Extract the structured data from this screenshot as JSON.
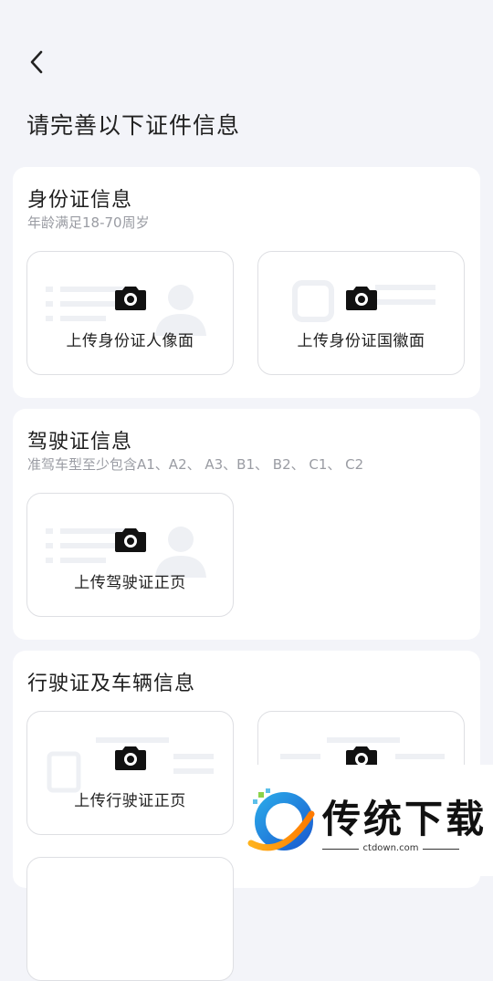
{
  "page": {
    "title": "请完善以下证件信息"
  },
  "id_card": {
    "title": "身份证信息",
    "subtitle": "年龄满足18-70周岁",
    "front_label": "上传身份证人像面",
    "back_label": "上传身份证国徽面"
  },
  "driver_license": {
    "title": "驾驶证信息",
    "subtitle": "准驾车型至少包含A1、A2、 A3、B1、 B2、 C1、 C2",
    "front_label": "上传驾驶证正页"
  },
  "vehicle_license": {
    "title": "行驶证及车辆信息",
    "front_label": "上传行驶证正页"
  },
  "watermark": {
    "brand": "传统下载",
    "url": "ctdown.com"
  },
  "colors": {
    "background": "#f3f4f9",
    "card": "#ffffff",
    "border": "#dedfe3",
    "muted": "#9a9ca3"
  }
}
